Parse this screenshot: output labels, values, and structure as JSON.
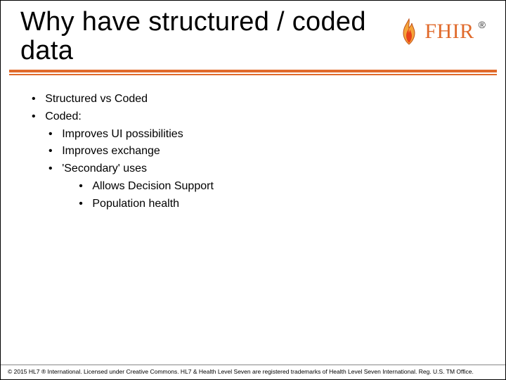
{
  "title": "Why have structured / coded data",
  "logo": {
    "text": "FHIR",
    "registered": "®"
  },
  "bullets": {
    "l0": [
      "Structured vs Coded",
      "Coded:"
    ],
    "l1": [
      "Improves UI possibilities",
      "Improves exchange",
      "'Secondary' uses"
    ],
    "l2": [
      "Allows Decision Support",
      "Population health"
    ]
  },
  "footer": "© 2015 HL7 ® International. Licensed under Creative Commons. HL7 & Health Level Seven are registered trademarks of Health Level Seven International. Reg. U.S. TM Office."
}
